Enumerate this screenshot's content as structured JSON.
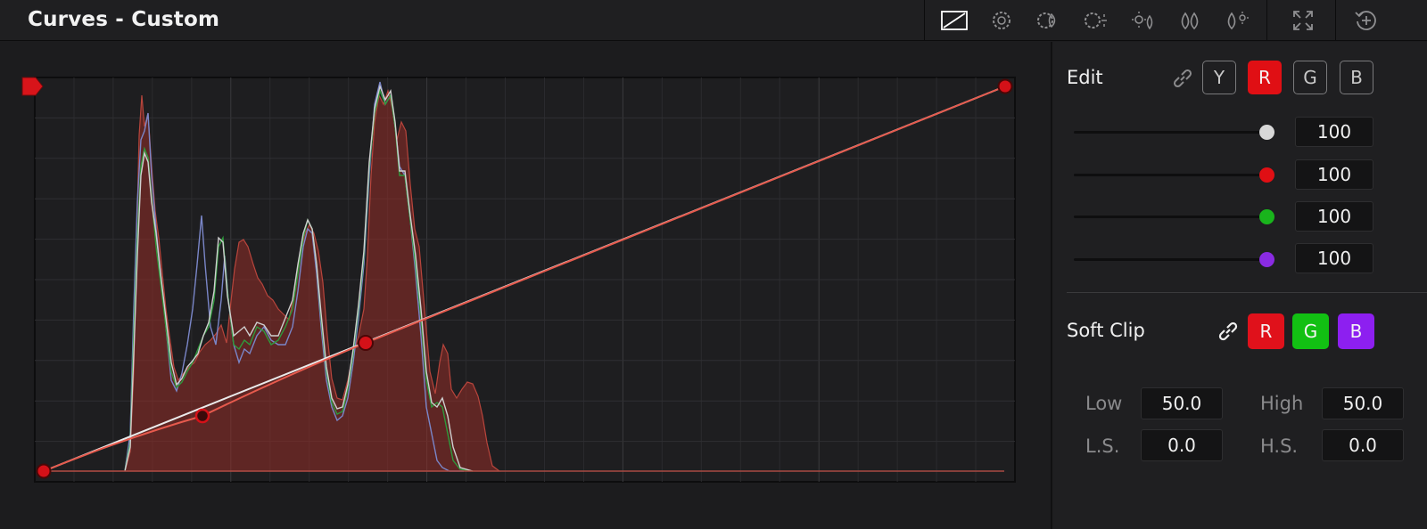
{
  "window": {
    "title": "Curves - Custom"
  },
  "toolbar": {
    "icons": [
      "curve-mode-icon",
      "hue-vs-hue-icon",
      "hue-vs-sat-icon",
      "hue-vs-lum-icon",
      "lum-vs-sat-icon",
      "sat-vs-sat-icon",
      "sat-vs-lum-icon",
      "expand-icon",
      "reset-icon"
    ]
  },
  "edit": {
    "label": "Edit",
    "link_icon": "link-icon",
    "channels": [
      "Y",
      "R",
      "G",
      "B"
    ],
    "active_channel": "R",
    "sliders": [
      {
        "channel": "Y",
        "value": "100",
        "color": "#d8d8d8"
      },
      {
        "channel": "R",
        "value": "100",
        "color": "#e00f14"
      },
      {
        "channel": "G",
        "value": "100",
        "color": "#19b41c"
      },
      {
        "channel": "B",
        "value": "100",
        "color": "#8a2be2"
      }
    ]
  },
  "soft_clip": {
    "label": "Soft Clip",
    "link_icon": "link-icon",
    "channels": [
      "R",
      "G",
      "B"
    ],
    "colors": {
      "R": "#e0111b",
      "G": "#12c013",
      "B": "#8d1ff0"
    },
    "low_label": "Low",
    "low_value": "50.0",
    "high_label": "High",
    "high_value": "50.0",
    "ls_label": "L.S.",
    "ls_value": "0.0",
    "hs_label": "H.S.",
    "hs_value": "0.0"
  },
  "colors": {
    "accent_red": "#e0111b",
    "panel_bg": "#1f1f21",
    "graph_bg": "#1c1c1e"
  }
}
